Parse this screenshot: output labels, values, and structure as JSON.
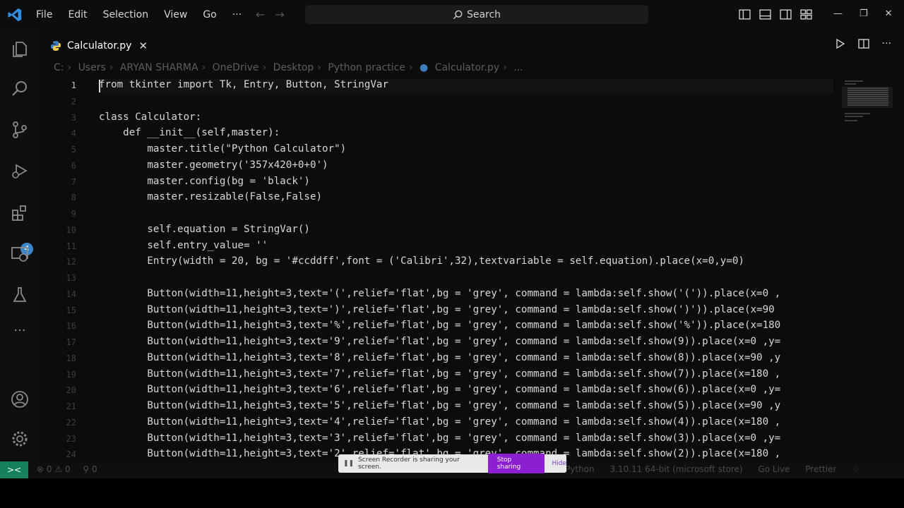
{
  "menu": [
    "File",
    "Edit",
    "Selection",
    "View",
    "Go",
    "···"
  ],
  "search": {
    "label": "Search"
  },
  "tab": {
    "filename": "Calculator.py",
    "close": "✕"
  },
  "breadcrumb": [
    "C:",
    "Users",
    "ARYAN SHARMA",
    "OneDrive",
    "Desktop",
    "Python practice",
    "Calculator.py",
    "..."
  ],
  "badge": "4",
  "code_lines": [
    {
      "n": "1",
      "t": "from tkinter import Tk, Entry, Button, StringVar"
    },
    {
      "n": "2",
      "t": ""
    },
    {
      "n": "3",
      "t": "class Calculator:"
    },
    {
      "n": "4",
      "t": "    def __init__(self,master):"
    },
    {
      "n": "5",
      "t": "        master.title(\"Python Calculator\")"
    },
    {
      "n": "6",
      "t": "        master.geometry('357x420+0+0')"
    },
    {
      "n": "7",
      "t": "        master.config(bg = 'black')"
    },
    {
      "n": "8",
      "t": "        master.resizable(False,False)"
    },
    {
      "n": "9",
      "t": ""
    },
    {
      "n": "10",
      "t": "        self.equation = StringVar()"
    },
    {
      "n": "11",
      "t": "        self.entry_value= ''"
    },
    {
      "n": "12",
      "t": "        Entry(width = 20, bg = '#ccddff',font = ('Calibri',32),textvariable = self.equation).place(x=0,y=0)"
    },
    {
      "n": "13",
      "t": ""
    },
    {
      "n": "14",
      "t": "        Button(width=11,height=3,text='(',relief='flat',bg = 'grey', command = lambda:self.show('(')).place(x=0 ,"
    },
    {
      "n": "15",
      "t": "        Button(width=11,height=3,text=')',relief='flat',bg = 'grey', command = lambda:self.show(')')).place(x=90"
    },
    {
      "n": "16",
      "t": "        Button(width=11,height=3,text='%',relief='flat',bg = 'grey', command = lambda:self.show('%')).place(x=180"
    },
    {
      "n": "17",
      "t": "        Button(width=11,height=3,text='9',relief='flat',bg = 'grey', command = lambda:self.show(9)).place(x=0 ,y="
    },
    {
      "n": "18",
      "t": "        Button(width=11,height=3,text='8',relief='flat',bg = 'grey', command = lambda:self.show(8)).place(x=90 ,y"
    },
    {
      "n": "19",
      "t": "        Button(width=11,height=3,text='7',relief='flat',bg = 'grey', command = lambda:self.show(7)).place(x=180 ,"
    },
    {
      "n": "20",
      "t": "        Button(width=11,height=3,text='6',relief='flat',bg = 'grey', command = lambda:self.show(6)).place(x=0 ,y="
    },
    {
      "n": "21",
      "t": "        Button(width=11,height=3,text='5',relief='flat',bg = 'grey', command = lambda:self.show(5)).place(x=90 ,y"
    },
    {
      "n": "22",
      "t": "        Button(width=11,height=3,text='4',relief='flat',bg = 'grey', command = lambda:self.show(4)).place(x=180 ,"
    },
    {
      "n": "23",
      "t": "        Button(width=11,height=3,text='3',relief='flat',bg = 'grey', command = lambda:self.show(3)).place(x=0 ,y="
    },
    {
      "n": "24",
      "t": "        Button(width=11,height=3,text='2',relief='flat',bg = 'grey', command = lambda:self.show(2)).place(x=180 ,"
    }
  ],
  "status": {
    "remote": "><",
    "problems": "⊗ 0 ⚠ 0",
    "ports": "⚲ 0",
    "language": "Python",
    "interpreter": "3.10.11 64-bit (microsoft store)",
    "golive": "Go Live",
    "prettier": "Prettier"
  },
  "share_bar": {
    "message": "Screen Recorder is sharing your screen.",
    "stop": "Stop sharing",
    "hide": "Hide"
  },
  "colors": {
    "keyword": "#c586c0",
    "function": "#dcdcaa",
    "string": "#ce9178",
    "param": "#9cdcfe",
    "class": "#4ec9b0"
  }
}
